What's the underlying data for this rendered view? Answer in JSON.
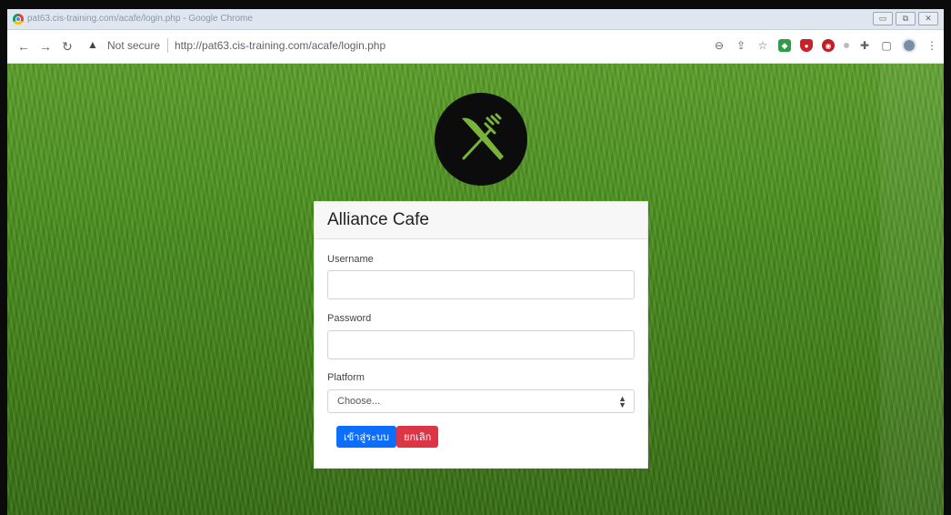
{
  "window": {
    "title": "pat63.cis-training.com/acafe/login.php - Google Chrome"
  },
  "toolbar": {
    "security_label": "Not secure",
    "url": "http://pat63.cis-training.com/acafe/login.php",
    "icons": [
      "back-icon",
      "forward-icon",
      "reload-icon",
      "warning-icon",
      "zoom-icon",
      "share-icon",
      "star-icon",
      "extension-icon",
      "puzzle-icon",
      "sidepanel-icon",
      "profile-icon",
      "menu-icon"
    ]
  },
  "login": {
    "title": "Alliance Cafe",
    "username_label": "Username",
    "password_label": "Password",
    "platform_label": "Platform",
    "platform_selected": "Choose...",
    "submit_label": "เข้าสู่ระบบ",
    "cancel_label": "ยกเลิก"
  },
  "colors": {
    "primary": "#0d6efd",
    "danger": "#dc3545",
    "logo_bg": "#0c0c0c",
    "grass": "#4a8f1e"
  }
}
